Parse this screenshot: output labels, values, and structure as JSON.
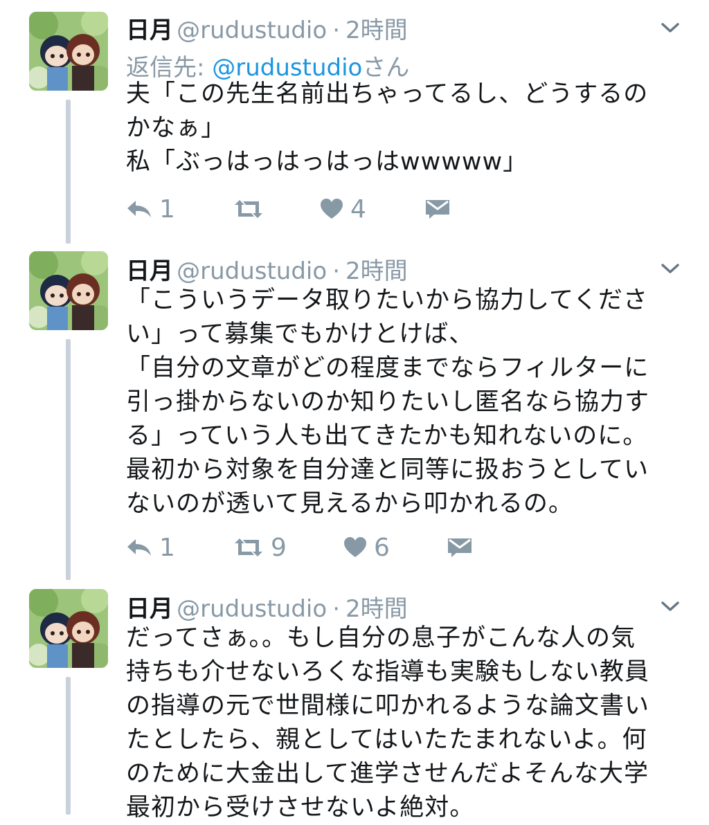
{
  "colors": {
    "accent": "#1b95e0",
    "muted": "#8899a6",
    "text": "#14171a",
    "thread_line": "#c9d2db"
  },
  "tweets": [
    {
      "name": "日月",
      "handle": "@rudustudio",
      "separator": "·",
      "time": "2時間",
      "reply_to_prefix": "返信先: ",
      "reply_to_user": "@rudustudio",
      "reply_to_suffix": "さん",
      "lines": [
        "夫「この先生名前出ちゃってるし、どうするの",
        "かなぁ」",
        "私「ぶっはっはっはっはwwwww」"
      ],
      "replies": "1",
      "retweets": "",
      "likes": "4"
    },
    {
      "name": "日月",
      "handle": "@rudustudio",
      "separator": "·",
      "time": "2時間",
      "lines": [
        "「こういうデータ取りたいから協力してくださ",
        "い」って募集でもかけとけば、",
        "「自分の文章がどの程度までならフィルターに",
        "引っ掛からないのか知りたいし匿名なら協力す",
        "る」っていう人も出てきたかも知れないのに。",
        "最初から対象を自分達と同等に扱おうとしてい",
        "ないのが透いて見えるから叩かれるの。"
      ],
      "replies": "1",
      "retweets": "9",
      "likes": "6"
    },
    {
      "name": "日月",
      "handle": "@rudustudio",
      "separator": "·",
      "time": "2時間",
      "lines": [
        "だってさぁ。。もし自分の息子がこんな人の気",
        "持ちも介せないろくな指導も実験もしない教員",
        "の指導の元で世間様に叩かれるような論文書い",
        "たとしたら、親としてはいたたまれないよ。何",
        "のために大金出して進学させんだよそんな大学",
        "最初から受けさせないよ絶対。"
      ]
    }
  ]
}
